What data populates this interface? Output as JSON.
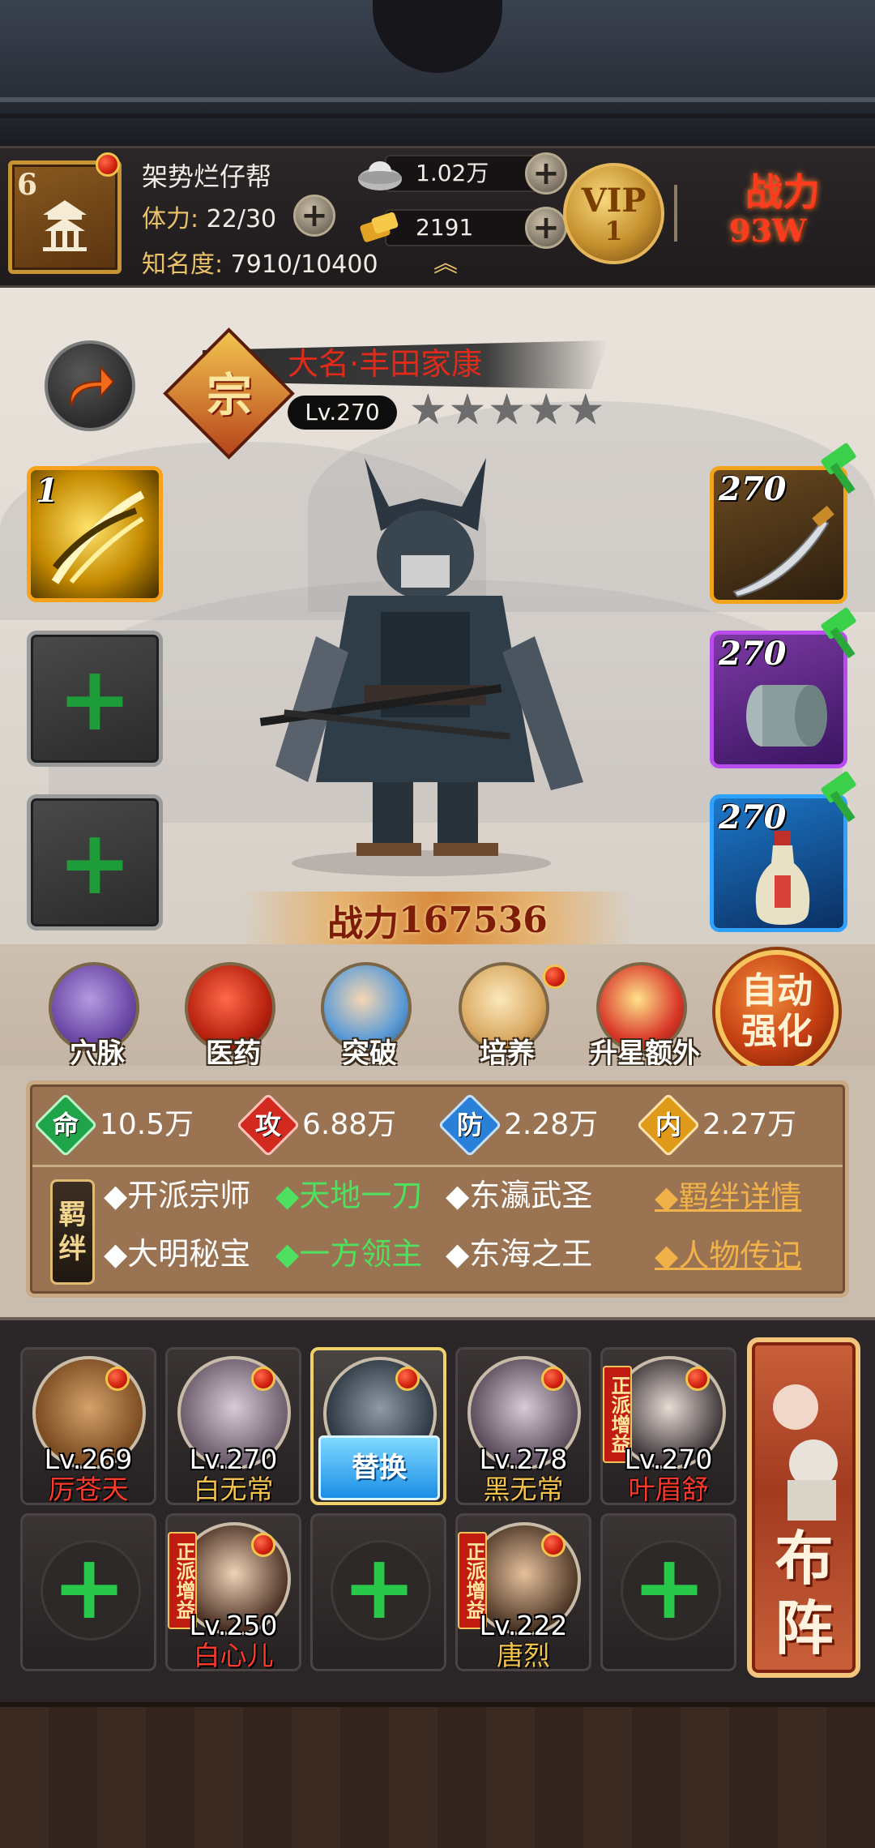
{
  "player": {
    "level": "6",
    "guild_name": "架势烂仔帮",
    "stamina_label": "体力:",
    "stamina_value": "22/30",
    "fame_label": "知名度:",
    "fame_value": "7910/10400",
    "silver": "1.02万",
    "gold": "2191",
    "vip_label": "VIP",
    "vip_level": "1",
    "power_label": "战力",
    "power_value": "93W"
  },
  "hero": {
    "camp_char": "宗",
    "name": "大名·丰田家康",
    "level": "Lv.270",
    "stars_total": 5,
    "stars_lit": 0,
    "power_label": "战力",
    "power_value": "167536",
    "skill_slot_level": "1",
    "equipment": [
      {
        "level": "270",
        "type": "weapon",
        "quality": "orange"
      },
      {
        "level": "270",
        "type": "armor-bracer",
        "quality": "purple"
      },
      {
        "level": "270",
        "type": "medicine-bottle",
        "quality": "blue"
      }
    ]
  },
  "functions": [
    {
      "label": "穴脉",
      "icon": "meridian-icon",
      "badge": false
    },
    {
      "label": "医药",
      "icon": "herb-icon",
      "badge": false
    },
    {
      "label": "突破",
      "icon": "breakthrough-icon",
      "badge": false
    },
    {
      "label": "培养",
      "icon": "scroll-icon",
      "badge": true
    },
    {
      "label": "升星额外",
      "icon": "treasure-icon",
      "badge": false
    }
  ],
  "auto_enhance": {
    "line1": "自动",
    "line2": "强化"
  },
  "stats": [
    {
      "char": "命",
      "value": "10.5万",
      "color": "#1fa44a"
    },
    {
      "char": "攻",
      "value": "6.88万",
      "color": "#d32a20"
    },
    {
      "char": "防",
      "value": "2.28万",
      "color": "#2a7fd6"
    },
    {
      "char": "内",
      "value": "2.27万",
      "color": "#e09a1a"
    }
  ],
  "bonds": {
    "tag_line1": "羁",
    "tag_line2": "绊",
    "row1": [
      {
        "text": "◆开派宗师",
        "active": false
      },
      {
        "text": "◆天地一刀",
        "active": true
      },
      {
        "text": "◆东瀛武圣",
        "active": false
      }
    ],
    "row2": [
      {
        "text": "◆大明秘宝",
        "active": false
      },
      {
        "text": "◆一方领主",
        "active": true
      },
      {
        "text": "◆东海之王",
        "active": false
      }
    ],
    "detail_link": "◆羁绊详情",
    "bio_link": "◆人物传记"
  },
  "team": {
    "row1": [
      {
        "level": "Lv.269",
        "name": "厉苍天",
        "name_color": "red",
        "faction": "",
        "badge": true
      },
      {
        "level": "Lv.270",
        "name": "白无常",
        "name_color": "gold",
        "faction": "",
        "badge": true
      },
      {
        "level": "",
        "name": "",
        "name_color": "",
        "faction": "",
        "badge": true,
        "selected": true,
        "replace_label": "替换"
      },
      {
        "level": "Lv.278",
        "name": "黑无常",
        "name_color": "gold",
        "faction": "",
        "badge": true
      },
      {
        "level": "Lv.270",
        "name": "叶眉舒",
        "name_color": "red",
        "faction": "正派增益",
        "badge": true
      }
    ],
    "row2": [
      {
        "empty": true
      },
      {
        "level": "Lv.250",
        "name": "白心儿",
        "name_color": "red",
        "faction": "正派增益",
        "badge": true
      },
      {
        "empty": true
      },
      {
        "level": "Lv.222",
        "name": "唐烈",
        "name_color": "gold",
        "faction": "正派增益",
        "badge": true
      },
      {
        "empty": true
      }
    ],
    "formation_line1": "布",
    "formation_line2": "阵"
  }
}
